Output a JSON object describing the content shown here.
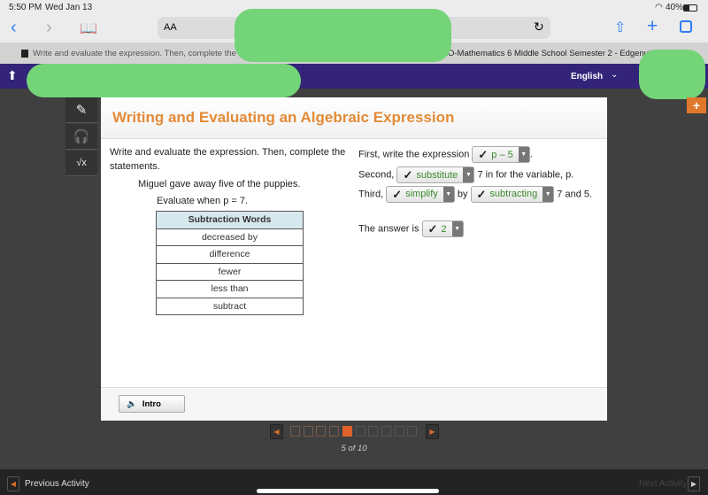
{
  "status": {
    "time": "5:50 PM",
    "date": "Wed Jan 13",
    "battery": "40%"
  },
  "browser": {
    "aa_label": "AA",
    "tabs": [
      "Write and evaluate the expression. Then, complete the stat...",
      "2020-2021 MO-Mathematics 6 Middle School Semester 2 - Edgenuity.com"
    ]
  },
  "header": {
    "language": "English"
  },
  "panel": {
    "title": "Writing and Evaluating an Algebraic Expression",
    "instructions": "Write and evaluate the expression. Then, complete the statements.",
    "scenario": "Miguel gave away five of the puppies.",
    "evaluate": "Evaluate when p = 7.",
    "table": {
      "header": "Subtraction Words",
      "rows": [
        "decreased by",
        "difference",
        "fewer",
        "less than",
        "subtract"
      ]
    },
    "s1": {
      "pre": "First, write the expression",
      "answer": "p – 5",
      "post": "."
    },
    "s2": {
      "pre": "Second,",
      "answer": "substitute",
      "post": "7 in for the variable, p."
    },
    "s3": {
      "pre": "Third,",
      "answer1": "simplify",
      "mid": "by",
      "answer2": "subtracting",
      "post": "7 and 5."
    },
    "s4": {
      "pre": "The answer is",
      "answer": "2"
    },
    "intro_label": "Intro"
  },
  "pagination": {
    "current": 5,
    "total": 10,
    "label": "5 of 10"
  },
  "footer": {
    "prev": "Previous Activity",
    "next": "Next Activity"
  },
  "colors": {
    "accent": "#e38b37",
    "brand": "#33247a",
    "correct": "#3a8a2a"
  }
}
